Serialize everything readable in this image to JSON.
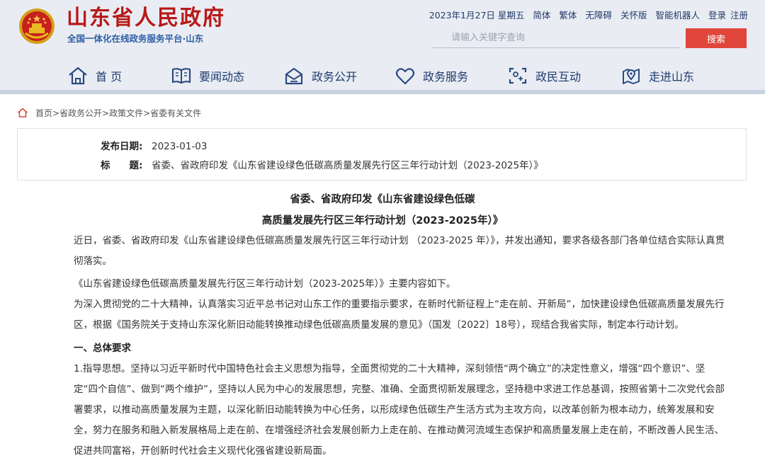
{
  "header": {
    "site_title": "山东省人民政府",
    "site_subtitle": "全国一体化在线政务服务平台·山东",
    "colors": {
      "title_red": "#b71a1a",
      "nav_blue": "#1e3a6e",
      "search_red": "#e0463a",
      "header_bg": "#e9edf3"
    },
    "toplinks": {
      "date": "2023年1月27日 星期五",
      "simplified": "简体",
      "traditional": "繁体",
      "accessible": "无障碍",
      "care": "关怀版",
      "robot": "智能机器人",
      "login": "登录",
      "register": "注册"
    },
    "search": {
      "placeholder": "请输入关键字查询",
      "button": "搜索"
    },
    "nav": [
      {
        "label": "首 页",
        "icon": "home-icon"
      },
      {
        "label": "要闻动态",
        "icon": "book-icon"
      },
      {
        "label": "政务公开",
        "icon": "inbox-icon"
      },
      {
        "label": "政务服务",
        "icon": "heart-icon"
      },
      {
        "label": "政民互动",
        "icon": "interaction-icon"
      },
      {
        "label": "走进山东",
        "icon": "location-icon"
      }
    ]
  },
  "breadcrumb": "首页>省政务公开>政策文件>省委有关文件",
  "info": {
    "date_label": "发布日期:",
    "date_value": "2023-01-03",
    "title_label": "标　　题:",
    "title_value": "省委、省政府印发《山东省建设绿色低碳高质量发展先行区三年行动计划（2023-2025年）》"
  },
  "article": {
    "title_line1": "省委、省政府印发《山东省建设绿色低碳",
    "title_line2": "高质量发展先行区三年行动计划（2023-2025年）》",
    "p1": "近日，省委、省政府印发《山东省建设绿色低碳高质量发展先行区三年行动计划 （2023-2025 年）》，并发出通知，要求各级各部门各单位结合实际认真贯彻落实。",
    "p2": "《山东省建设绿色低碳高质量发展先行区三年行动计划（2023-2025年）》主要内容如下。",
    "p3": "为深入贯彻党的二十大精神，认真落实习近平总书记对山东工作的重要指示要求，在新时代新征程上“走在前、开新局”，加快建设绿色低碳高质量发展先行区，根据《国务院关于支持山东深化新旧动能转换推动绿色低碳高质量发展的意见》（国发〔2022〕18号），现结合我省实际，制定本行动计划。",
    "h1": "一、总体要求",
    "p4": "1.指导思想。坚持以习近平新时代中国特色社会主义思想为指导，全面贯彻党的二十大精神，深刻领悟“两个确立”的决定性意义，增强“四个意识”、坚定“四个自信”、做到“两个维护”，坚持以人民为中心的发展思想，完整、准确、全面贯彻新发展理念，坚持稳中求进工作总基调，按照省第十二次党代会部署要求，以推动高质量发展为主题，以深化新旧动能转换为中心任务，以形成绿色低碳生产生活方式为主攻方向，以改革创新为根本动力，统筹发展和安全，努力在服务和融入新发展格局上走在前、在增强经济社会发展创新力上走在前、在推动黄河流域生态保护和高质量发展上走在前，不断改善人民生活、促进共同富裕，开创新时代社会主义现代化强省建设新局面。"
  }
}
